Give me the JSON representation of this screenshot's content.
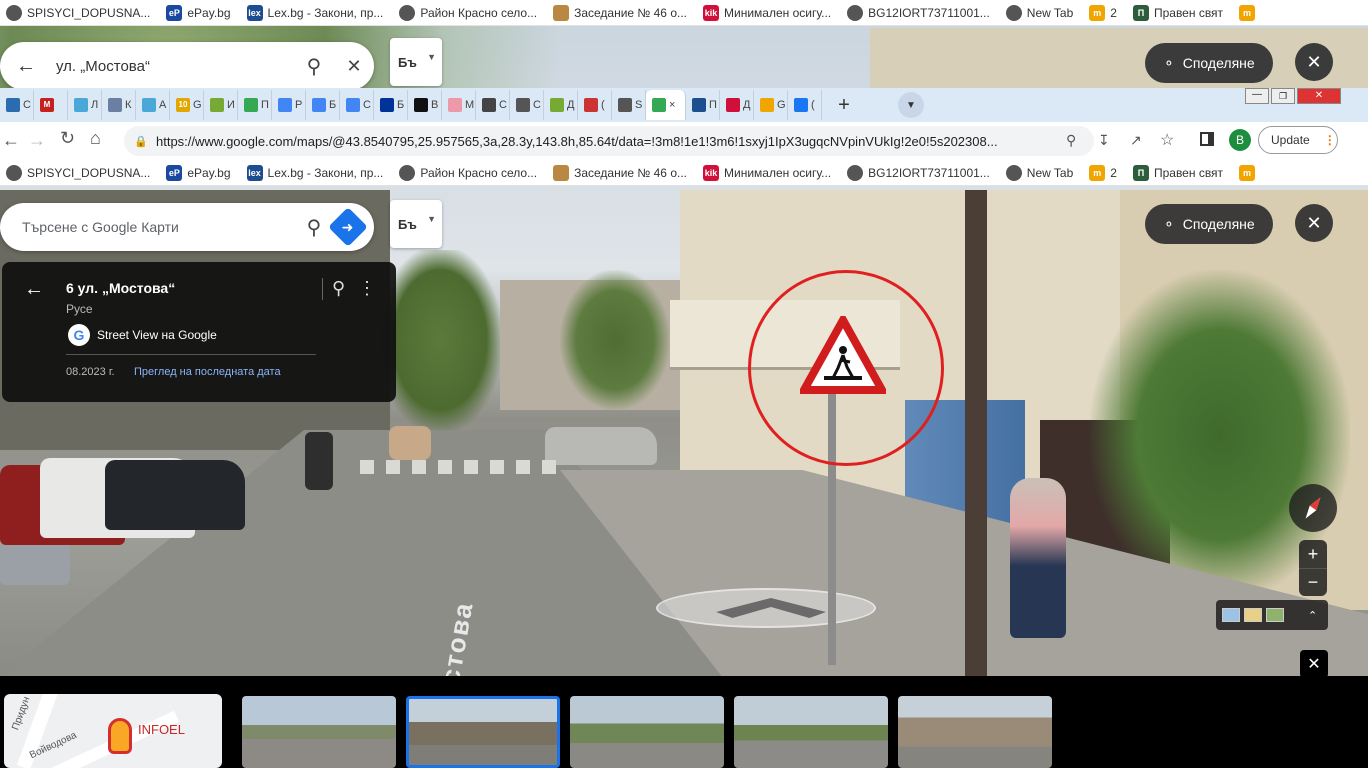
{
  "bookmarks": [
    {
      "label": "SPISYCI_DOPUSNA...",
      "icon": "globe-icon",
      "color": "#555"
    },
    {
      "label": "ePay.bg",
      "icon": "epay-icon",
      "color": "#1a4aa0",
      "glyph": "eP"
    },
    {
      "label": "Lex.bg - Закони, пр...",
      "icon": "lex-icon",
      "color": "#1d4e8f",
      "glyph": "lex"
    },
    {
      "label": "Район Красно село...",
      "icon": "globe-icon",
      "color": "#555"
    },
    {
      "label": "Заседание № 46 о...",
      "icon": "crest-icon",
      "color": "#b84"
    },
    {
      "label": "Минимален осигу...",
      "icon": "kik-icon",
      "color": "#d0103a",
      "glyph": "kik"
    },
    {
      "label": "BG12IORT73711001...",
      "icon": "globe-icon",
      "color": "#555"
    },
    {
      "label": "New Tab",
      "icon": "globe-icon",
      "color": "#555"
    },
    {
      "label": "2",
      "icon": "m-icon",
      "color": "#f0a500",
      "glyph": "m"
    },
    {
      "label": "Правен свят",
      "icon": "pravensvyat-icon",
      "color": "#2d5d3a",
      "glyph": "П"
    },
    {
      "label": "",
      "icon": "m-icon",
      "color": "#f0a500",
      "glyph": "m"
    }
  ],
  "top_overlay": {
    "search_value": "ул. „Мостова“",
    "lang_label": "Бъ",
    "share_label": "Споделяне"
  },
  "tabs": [
    {
      "label": "С",
      "color": "#2b6cb0"
    },
    {
      "label": "",
      "color": "#c5221f",
      "glyph": "M"
    },
    {
      "label": "Л",
      "color": "#4aa8d8"
    },
    {
      "label": "К",
      "color": "#6b7fa3"
    },
    {
      "label": "А",
      "color": "#4aa8d8"
    },
    {
      "label": "G",
      "color": "#e0a800",
      "glyph": "10"
    },
    {
      "label": "И",
      "color": "#7a3"
    },
    {
      "label": "П",
      "color": "#34a853"
    },
    {
      "label": "Р",
      "color": "#4285f4"
    },
    {
      "label": "Б",
      "color": "#4285f4"
    },
    {
      "label": "С",
      "color": "#4285f4"
    },
    {
      "label": "Б",
      "color": "#003399"
    },
    {
      "label": "В",
      "color": "#111"
    },
    {
      "label": "М",
      "color": "#e9a"
    },
    {
      "label": "С",
      "color": "#444"
    },
    {
      "label": "С",
      "color": "#555"
    },
    {
      "label": "Д",
      "color": "#7a3"
    },
    {
      "label": "(",
      "color": "#c33"
    },
    {
      "label": "S",
      "color": "#555"
    },
    {
      "label": "×",
      "color": "#34a853",
      "active": true
    },
    {
      "label": "П",
      "color": "#1d4e8f"
    },
    {
      "label": "Д",
      "color": "#d0103a"
    },
    {
      "label": "G",
      "color": "#f0a500"
    },
    {
      "label": "(",
      "color": "#1877f2"
    }
  ],
  "browser": {
    "url": "https://www.google.com/maps/@43.8540795,25.957565,3a,28.3y,143.8h,85.64t/data=!3m8!1e1!3m6!1sxyj1IpX3ugqcNVpinVUkIg!2e0!5s202308...",
    "profile_letter": "B",
    "update_label": "Update"
  },
  "maps": {
    "search_placeholder": "Търсене с Google Карти",
    "lang_label": "Бъ",
    "share_label": "Споделяне",
    "place_title": "6 ул. „Мостова“",
    "place_city": "Русе",
    "street_view_label": "Street View на Google",
    "date": "08.2023 г.",
    "history_link": "Преглед на последната дата"
  },
  "minimap": {
    "street1": "Придун",
    "street2": "Войводова",
    "poi": "INFOEL"
  },
  "colors": {
    "accent": "#1a73e8",
    "circle": "#e02020",
    "tabstrip": "#dbe8f6",
    "link": "#8ab4f8"
  }
}
